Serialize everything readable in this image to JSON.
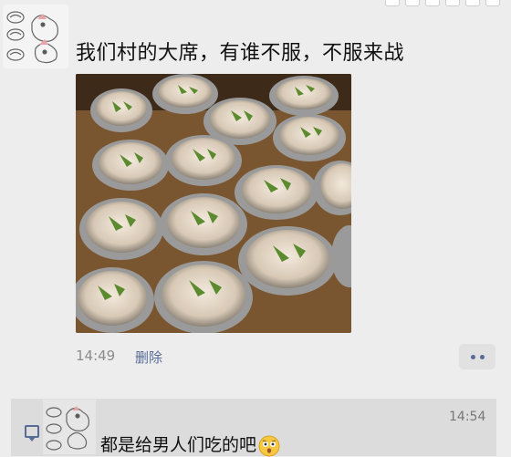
{
  "post": {
    "text": "我们村的大席，有谁不服，不服来战",
    "timestamp": "14:49",
    "delete_label": "删除",
    "image_icon": "food-photo"
  },
  "actions": {
    "more_icon": "more-dots-icon"
  },
  "comment": {
    "time": "14:54",
    "text": "都是给男人们吃的吧",
    "emoji": "shocked-face-emoji"
  },
  "colors": {
    "link": "#576b95",
    "background": "#ededed",
    "comment_panel": "#dcdcdc"
  }
}
